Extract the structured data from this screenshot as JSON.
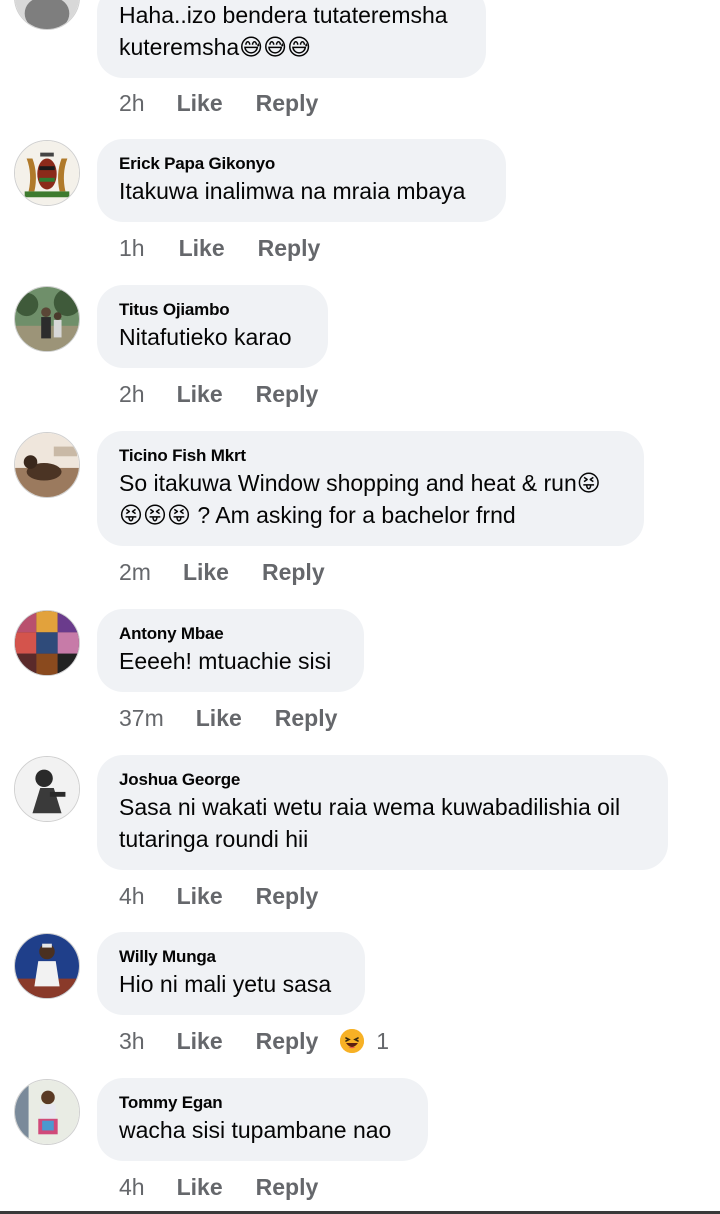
{
  "comments": [
    {
      "author": "",
      "text": "Haha..izo bendera tutateremsha kuteremsha😅😅😅",
      "time": "2h",
      "like": "Like",
      "reply": "Reply"
    },
    {
      "author": "Erick Papa Gikonyo",
      "text": "Itakuwa inalimwa na mraia mbaya",
      "time": "1h",
      "like": "Like",
      "reply": "Reply"
    },
    {
      "author": "Titus Ojiambo",
      "text": "Nitafutieko karao",
      "time": "2h",
      "like": "Like",
      "reply": "Reply"
    },
    {
      "author": "Ticino Fish Mkrt",
      "text": "So itakuwa Window shopping and heat & run😝😝😝😝 ? Am asking for a bachelor frnd",
      "time": "2m",
      "like": "Like",
      "reply": "Reply"
    },
    {
      "author": "Antony Mbae",
      "text": "Eeeeh! mtuachie sisi",
      "time": "37m",
      "like": "Like",
      "reply": "Reply"
    },
    {
      "author": "Joshua George",
      "text": "Sasa ni wakati wetu raia wema kuwabadilishia oil tutaringa roundi hii",
      "time": "4h",
      "like": "Like",
      "reply": "Reply"
    },
    {
      "author": "Willy Munga",
      "text": "Hio ni mali yetu sasa",
      "time": "3h",
      "like": "Like",
      "reply": "Reply",
      "reaction": {
        "icon": "haha-reaction-icon",
        "count": "1"
      }
    },
    {
      "author": "Tommy Egan",
      "text": "wacha sisi tupambane nao",
      "time": "4h",
      "like": "Like",
      "reply": "Reply"
    }
  ],
  "colors": {
    "bubble": "#f0f2f5",
    "meta": "#65676b",
    "text": "#050505",
    "reaction": "#f7b125"
  }
}
